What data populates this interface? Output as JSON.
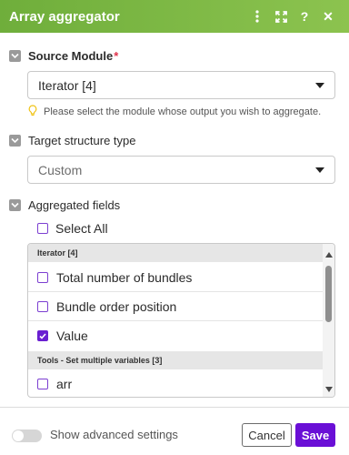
{
  "header": {
    "title": "Array aggregator",
    "background_color": "#7bb845",
    "icons": [
      "more-vertical-icon",
      "expand-icon",
      "help-icon",
      "close-icon"
    ],
    "help_glyph": "?",
    "close_glyph": "✕"
  },
  "source_module": {
    "label": "Source Module",
    "required_mark": "*",
    "value": "Iterator [4]",
    "hint": "Please select the module whose output you wish to aggregate."
  },
  "target_structure": {
    "label": "Target structure type",
    "value": "Custom"
  },
  "aggregated_fields": {
    "label": "Aggregated fields",
    "select_all_label": "Select All",
    "groups": [
      {
        "title": "Iterator [4]",
        "items": [
          {
            "label": "Total number of bundles",
            "checked": false
          },
          {
            "label": "Bundle order position",
            "checked": false
          },
          {
            "label": "Value",
            "checked": true
          }
        ]
      },
      {
        "title": "Tools - Set multiple variables [3]",
        "items": [
          {
            "label": "arr",
            "checked": false
          }
        ]
      }
    ]
  },
  "footer": {
    "advanced_label": "Show advanced settings",
    "advanced_enabled": false,
    "cancel_label": "Cancel",
    "save_label": "Save"
  },
  "colors": {
    "accent": "#6a0fd6",
    "required": "#e0334b"
  }
}
